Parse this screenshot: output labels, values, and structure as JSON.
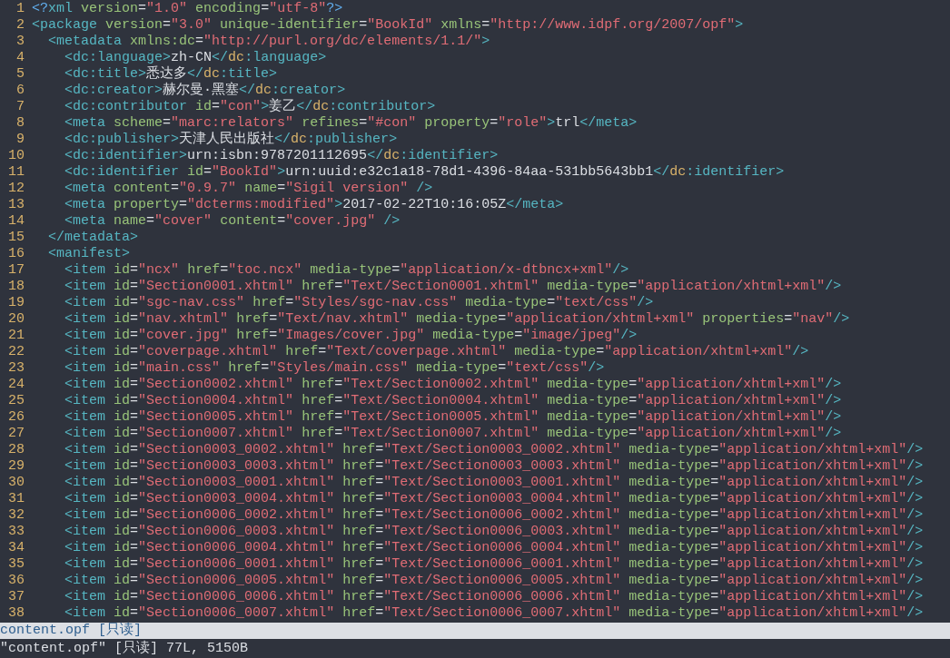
{
  "editor": {
    "lines": [
      {
        "number": "1",
        "text": "<?xml version=\"1.0\" encoding=\"utf-8\"?>"
      },
      {
        "number": "2",
        "text": "<package version=\"3.0\" unique-identifier=\"BookId\" xmlns=\"http://www.idpf.org/2007/opf\">"
      },
      {
        "number": "3",
        "text": "  <metadata xmlns:dc=\"http://purl.org/dc/elements/1.1/\">"
      },
      {
        "number": "4",
        "text": "    <dc:language>zh-CN</dc:language>"
      },
      {
        "number": "5",
        "text": "    <dc:title>悉达多</dc:title>"
      },
      {
        "number": "6",
        "text": "    <dc:creator>赫尔曼·黑塞</dc:creator>"
      },
      {
        "number": "7",
        "text": "    <dc:contributor id=\"con\">姜乙</dc:contributor>"
      },
      {
        "number": "8",
        "text": "    <meta scheme=\"marc:relators\" refines=\"#con\" property=\"role\">trl</meta>"
      },
      {
        "number": "9",
        "text": "    <dc:publisher>天津人民出版社</dc:publisher>"
      },
      {
        "number": "10",
        "text": "    <dc:identifier>urn:isbn:9787201112695</dc:identifier>"
      },
      {
        "number": "11",
        "text": "    <dc:identifier id=\"BookId\">urn:uuid:e32c1a18-78d1-4396-84aa-531bb5643bb1</dc:identifier>"
      },
      {
        "number": "12",
        "text": "    <meta content=\"0.9.7\" name=\"Sigil version\" />"
      },
      {
        "number": "13",
        "text": "    <meta property=\"dcterms:modified\">2017-02-22T10:16:05Z</meta>"
      },
      {
        "number": "14",
        "text": "    <meta name=\"cover\" content=\"cover.jpg\" />"
      },
      {
        "number": "15",
        "text": "  </metadata>"
      },
      {
        "number": "16",
        "text": "  <manifest>"
      },
      {
        "number": "17",
        "text": "    <item id=\"ncx\" href=\"toc.ncx\" media-type=\"application/x-dtbncx+xml\"/>"
      },
      {
        "number": "18",
        "text": "    <item id=\"Section0001.xhtml\" href=\"Text/Section0001.xhtml\" media-type=\"application/xhtml+xml\"/>"
      },
      {
        "number": "19",
        "text": "    <item id=\"sgc-nav.css\" href=\"Styles/sgc-nav.css\" media-type=\"text/css\"/>"
      },
      {
        "number": "20",
        "text": "    <item id=\"nav.xhtml\" href=\"Text/nav.xhtml\" media-type=\"application/xhtml+xml\" properties=\"nav\"/>"
      },
      {
        "number": "21",
        "text": "    <item id=\"cover.jpg\" href=\"Images/cover.jpg\" media-type=\"image/jpeg\"/>"
      },
      {
        "number": "22",
        "text": "    <item id=\"coverpage.xhtml\" href=\"Text/coverpage.xhtml\" media-type=\"application/xhtml+xml\"/>"
      },
      {
        "number": "23",
        "text": "    <item id=\"main.css\" href=\"Styles/main.css\" media-type=\"text/css\"/>"
      },
      {
        "number": "24",
        "text": "    <item id=\"Section0002.xhtml\" href=\"Text/Section0002.xhtml\" media-type=\"application/xhtml+xml\"/>"
      },
      {
        "number": "25",
        "text": "    <item id=\"Section0004.xhtml\" href=\"Text/Section0004.xhtml\" media-type=\"application/xhtml+xml\"/>"
      },
      {
        "number": "26",
        "text": "    <item id=\"Section0005.xhtml\" href=\"Text/Section0005.xhtml\" media-type=\"application/xhtml+xml\"/>"
      },
      {
        "number": "27",
        "text": "    <item id=\"Section0007.xhtml\" href=\"Text/Section0007.xhtml\" media-type=\"application/xhtml+xml\"/>"
      },
      {
        "number": "28",
        "text": "    <item id=\"Section0003_0002.xhtml\" href=\"Text/Section0003_0002.xhtml\" media-type=\"application/xhtml+xml\"/>"
      },
      {
        "number": "29",
        "text": "    <item id=\"Section0003_0003.xhtml\" href=\"Text/Section0003_0003.xhtml\" media-type=\"application/xhtml+xml\"/>"
      },
      {
        "number": "30",
        "text": "    <item id=\"Section0003_0001.xhtml\" href=\"Text/Section0003_0001.xhtml\" media-type=\"application/xhtml+xml\"/>"
      },
      {
        "number": "31",
        "text": "    <item id=\"Section0003_0004.xhtml\" href=\"Text/Section0003_0004.xhtml\" media-type=\"application/xhtml+xml\"/>"
      },
      {
        "number": "32",
        "text": "    <item id=\"Section0006_0002.xhtml\" href=\"Text/Section0006_0002.xhtml\" media-type=\"application/xhtml+xml\"/>"
      },
      {
        "number": "33",
        "text": "    <item id=\"Section0006_0003.xhtml\" href=\"Text/Section0006_0003.xhtml\" media-type=\"application/xhtml+xml\"/>"
      },
      {
        "number": "34",
        "text": "    <item id=\"Section0006_0004.xhtml\" href=\"Text/Section0006_0004.xhtml\" media-type=\"application/xhtml+xml\"/>"
      },
      {
        "number": "35",
        "text": "    <item id=\"Section0006_0001.xhtml\" href=\"Text/Section0006_0001.xhtml\" media-type=\"application/xhtml+xml\"/>"
      },
      {
        "number": "36",
        "text": "    <item id=\"Section0006_0005.xhtml\" href=\"Text/Section0006_0005.xhtml\" media-type=\"application/xhtml+xml\"/>"
      },
      {
        "number": "37",
        "text": "    <item id=\"Section0006_0006.xhtml\" href=\"Text/Section0006_0006.xhtml\" media-type=\"application/xhtml+xml\"/>"
      },
      {
        "number": "38",
        "text": "    <item id=\"Section0006_0007.xhtml\" href=\"Text/Section0006_0007.xhtml\" media-type=\"application/xhtml+xml\"/>"
      }
    ]
  },
  "status_line": {
    "text": "content.opf [只读]"
  },
  "command_line": {
    "text": "\"content.opf\" [只读] 77L, 5150B"
  }
}
